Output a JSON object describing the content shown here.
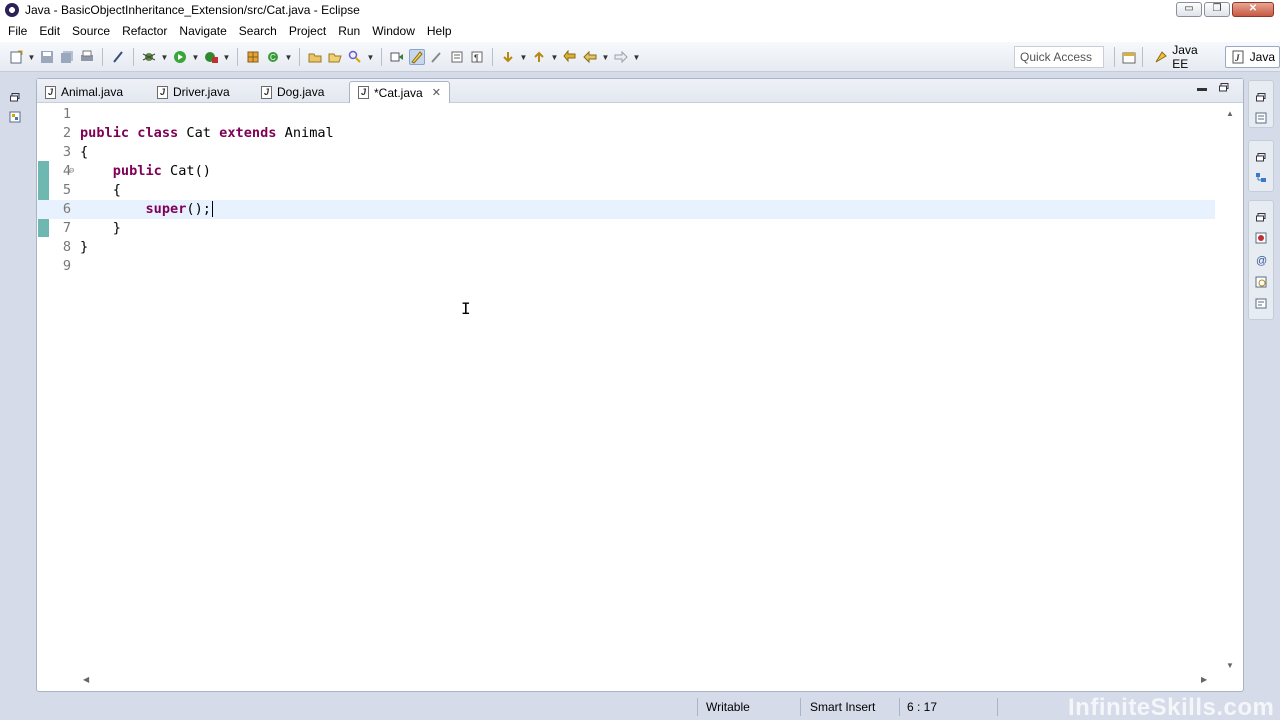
{
  "window": {
    "title": "Java - BasicObjectInheritance_Extension/src/Cat.java - Eclipse",
    "controls": {
      "minimize": "▭",
      "maximize": "❐",
      "close": "✕"
    }
  },
  "menu": [
    "File",
    "Edit",
    "Source",
    "Refactor",
    "Navigate",
    "Search",
    "Project",
    "Run",
    "Window",
    "Help"
  ],
  "toolbar": {
    "quick_access": "Quick Access",
    "perspectives": [
      {
        "label": "Java EE",
        "active": false
      },
      {
        "label": "Java",
        "active": true
      }
    ]
  },
  "editor": {
    "tabs": [
      {
        "label": "Animal.java",
        "active": false
      },
      {
        "label": "Driver.java",
        "active": false
      },
      {
        "label": "Dog.java",
        "active": false
      },
      {
        "label": "*Cat.java",
        "active": true
      }
    ],
    "line_numbers": [
      "1",
      "2",
      "3",
      "4",
      "5",
      "6",
      "7",
      "8",
      "9"
    ],
    "code": {
      "l2_kw1": "public",
      "l2_kw2": "class",
      "l2_name": "Cat",
      "l2_kw3": "extends",
      "l2_super": "Animal",
      "l3": "{",
      "l4_kw": "public",
      "l4_rest": "Cat()",
      "l5": "{",
      "l6_kw": "super",
      "l6_rest": "();",
      "l7": "}",
      "l8": "}"
    }
  },
  "status": {
    "writable": "Writable",
    "insert_mode": "Smart Insert",
    "position": "6 : 17"
  },
  "watermark": "InfiniteSkills.com",
  "colors": {
    "keyword": "#7f0055",
    "change_bar": "#6fb8b2",
    "current_line": "#e8f2fe"
  }
}
